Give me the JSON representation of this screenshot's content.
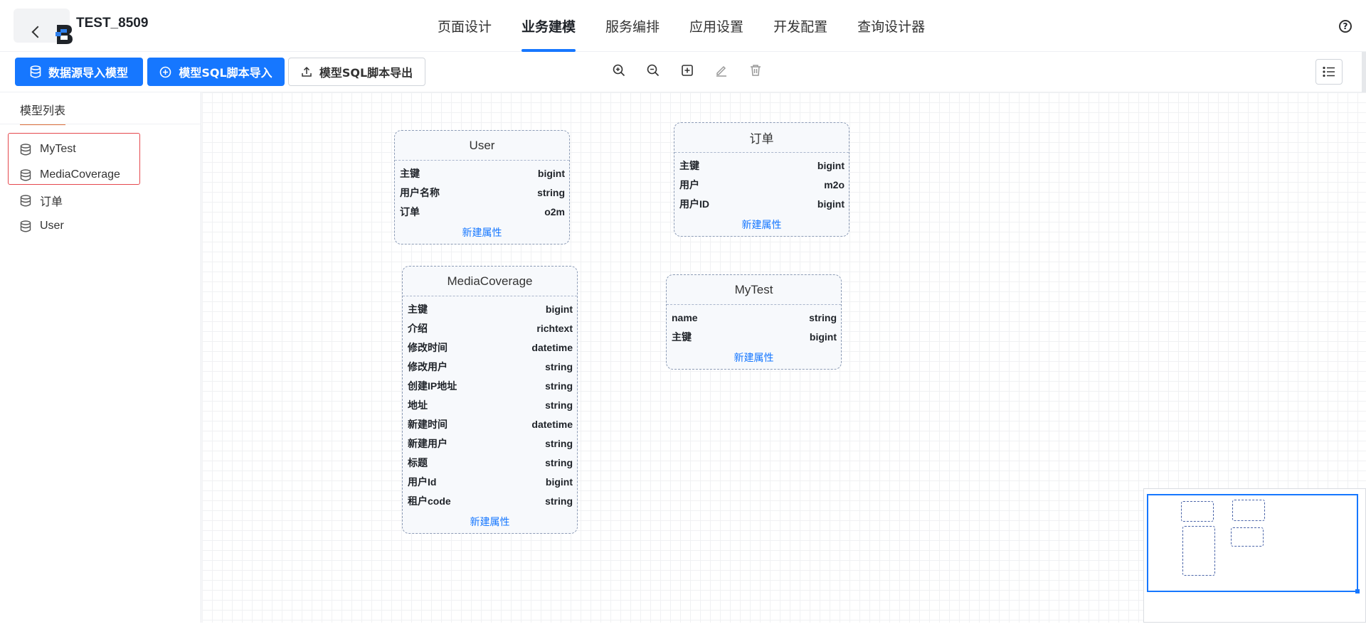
{
  "app": {
    "title": "TEST_8509"
  },
  "nav": {
    "tabs": [
      "页面设计",
      "业务建模",
      "服务编排",
      "应用设置",
      "开发配置",
      "查询设计器"
    ],
    "active": "业务建模",
    "help_icon": "help-circle-icon"
  },
  "toolbar": {
    "import_datasource_label": "数据源导入模型",
    "sql_import_label": "模型SQL脚本导入",
    "sql_export_label": "模型SQL脚本导出",
    "tools": [
      "zoom-in-icon",
      "zoom-out-icon",
      "fit-view-icon",
      "edit-icon",
      "delete-icon"
    ],
    "list_icon": "list-icon"
  },
  "sidebar": {
    "tab_label": "模型列表",
    "items": [
      "MyTest",
      "MediaCoverage",
      "订单",
      "User"
    ]
  },
  "entities": {
    "user": {
      "title": "User",
      "fields": [
        {
          "name": "主键",
          "type": "bigint"
        },
        {
          "name": "用户名称",
          "type": "string"
        },
        {
          "name": "订单",
          "type": "o2m"
        }
      ],
      "add_label": "新建属性"
    },
    "order": {
      "title": "订单",
      "fields": [
        {
          "name": "主键",
          "type": "bigint"
        },
        {
          "name": "用户",
          "type": "m2o"
        },
        {
          "name": "用户ID",
          "type": "bigint"
        }
      ],
      "add_label": "新建属性"
    },
    "media": {
      "title": "MediaCoverage",
      "fields": [
        {
          "name": "主键",
          "type": "bigint"
        },
        {
          "name": "介绍",
          "type": "richtext"
        },
        {
          "name": "修改时间",
          "type": "datetime"
        },
        {
          "name": "修改用户",
          "type": "string"
        },
        {
          "name": "创建IP地址",
          "type": "string"
        },
        {
          "name": "地址",
          "type": "string"
        },
        {
          "name": "新建时间",
          "type": "datetime"
        },
        {
          "name": "新建用户",
          "type": "string"
        },
        {
          "name": "标题",
          "type": "string"
        },
        {
          "name": "用户Id",
          "type": "bigint"
        },
        {
          "name": "租户code",
          "type": "string"
        }
      ],
      "add_label": "新建属性"
    },
    "mytest": {
      "title": "MyTest",
      "fields": [
        {
          "name": "name",
          "type": "string"
        },
        {
          "name": "主键",
          "type": "bigint"
        }
      ],
      "add_label": "新建属性"
    }
  },
  "colors": {
    "primary": "#1677ff",
    "highlight": "#e5484d",
    "accent_underline": "#e0703a"
  }
}
